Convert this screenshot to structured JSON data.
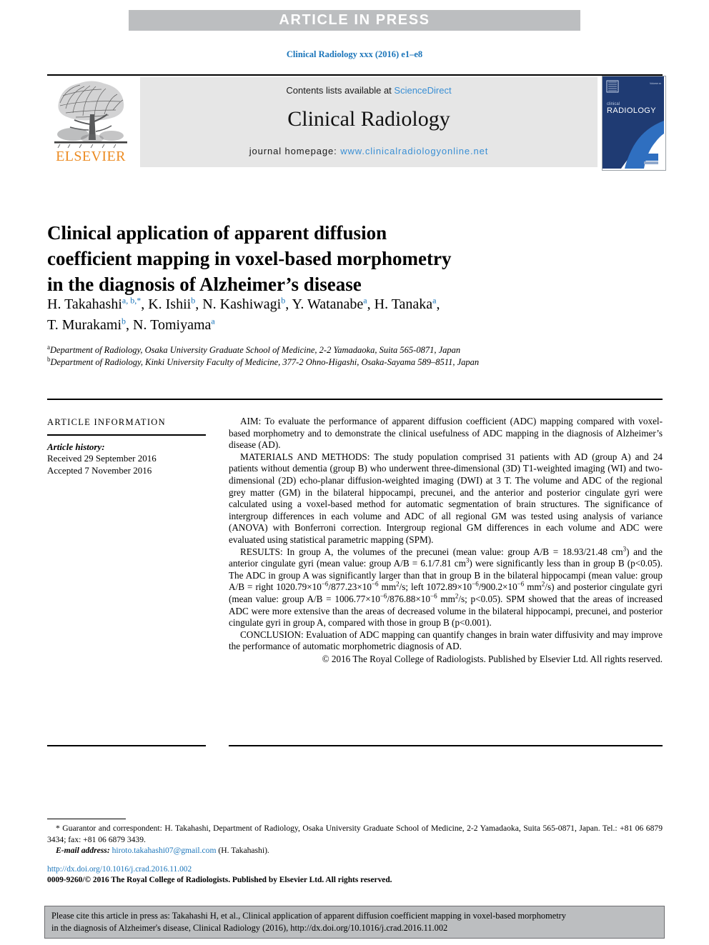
{
  "banner": {
    "text": "ARTICLE IN PRESS"
  },
  "running_head": "Clinical Radiology xxx (2016) e1–e8",
  "masthead": {
    "publisher_name": "ELSEVIER",
    "contents_prefix": "Contents lists available at ",
    "contents_link": "ScienceDirect",
    "journal_title": "Clinical Radiology",
    "homepage_prefix": "journal homepage: ",
    "homepage_link": "www.clinicalradiologyonline.net",
    "cover_title_small": "clinical",
    "cover_title_large": "RADIOLOGY",
    "accent_blue": "#1b75ba",
    "link_blue": "#3a8fd4",
    "elsevier_orange": "#ec8b22",
    "banner_grey": "#bcbec0",
    "masthead_grey": "#e6e6e6"
  },
  "article": {
    "title_line_1": "Clinical application of apparent diffusion",
    "title_line_2": "coefficient mapping in voxel-based morphometry",
    "title_line_3": "in the diagnosis of Alzheimer’s disease",
    "authors": [
      {
        "name": "H. Takahashi",
        "marks": "a, b,",
        "star": "*",
        "sep": ", "
      },
      {
        "name": "K. Ishii",
        "marks": "b",
        "star": "",
        "sep": ", "
      },
      {
        "name": "N. Kashiwagi",
        "marks": "b",
        "star": "",
        "sep": ", "
      },
      {
        "name": "Y. Watanabe",
        "marks": "a",
        "star": "",
        "sep": ", "
      },
      {
        "name": "H. Tanaka",
        "marks": "a",
        "star": "",
        "sep": ", "
      },
      {
        "name": "T. Murakami",
        "marks": "b",
        "star": "",
        "sep": ", "
      },
      {
        "name": "N. Tomiyama",
        "marks": "a",
        "star": "",
        "sep": ""
      }
    ],
    "affiliations": [
      {
        "mark": "a",
        "text": "Department of Radiology, Osaka University Graduate School of Medicine, 2-2 Yamadaoka, Suita 565-0871, Japan"
      },
      {
        "mark": "b",
        "text": "Department of Radiology, Kinki University Faculty of Medicine, 377-2 Ohno-Higashi, Osaka-Sayama 589–8511, Japan"
      }
    ]
  },
  "article_information": {
    "heading": "ARTICLE INFORMATION",
    "history_label": "Article history:",
    "received": "Received 29 September 2016",
    "accepted": "Accepted 7 November 2016"
  },
  "abstract": {
    "aim_label": "AIM:",
    "aim_text": " To evaluate the performance of apparent diffusion coefficient (ADC) mapping compared with voxel-based morphometry and to demonstrate the clinical usefulness of ADC mapping in the diagnosis of Alzheimer’s disease (AD).",
    "methods_label": "MATERIALS AND METHODS:",
    "methods_text": " The study population comprised 31 patients with AD (group A) and 24 patients without dementia (group B) who underwent three-dimensional (3D) T1-weighted imaging (WI) and two-dimensional (2D) echo-planar diffusion-weighted imaging (DWI) at 3 T. The volume and ADC of the regional grey matter (GM) in the bilateral hippocampi, precunei, and the anterior and posterior cingulate gyri were calculated using a voxel-based method for automatic segmentation of brain structures. The significance of intergroup differences in each volume and ADC of all regional GM was tested using analysis of variance (ANOVA) with Bonferroni correction. Intergroup regional GM differences in each volume and ADC were evaluated using statistical parametric mapping (SPM).",
    "results_label": "RESULTS:",
    "results_parts": {
      "p1": " In group A, the volumes of the precunei (mean value: group A/B = 18.93/21.48 cm",
      "sup1": "3",
      "p2": ") and the anterior cingulate gyri (mean value: group A/B = 6.1/7.81 cm",
      "sup2": "3",
      "p3": ") were significantly less than in group B (p<0.05). The ADC in group A was significantly larger than that in group B in the bilateral hippocampi (mean value: group A/B = right 1020.79×10",
      "sup3": "−6",
      "p4": "/877.23×10",
      "sup4": "−6",
      "p5": " mm",
      "sup5": "2",
      "p6": "/s; left 1072.89×10",
      "sup6": "−6",
      "p7": "/900.2×10",
      "sup7": "−6",
      "p8": " mm",
      "sup8": "2",
      "p9": "/s) and posterior cingulate gyri (mean value: group A/B = 1006.77×10",
      "sup9": "−6",
      "p10": "/876.88×10",
      "sup10": "−6",
      "p11": " mm",
      "sup11": "2",
      "p12": "/s; p<0.05). SPM showed that the areas of increased ADC were more extensive than the areas of decreased volume in the bilateral hippocampi, precunei, and posterior cingulate gyri in group A, compared with those in group B (p<0.001)."
    },
    "conclusion_label": "CONCLUSION:",
    "conclusion_text": " Evaluation of ADC mapping can quantify changes in brain water diffusivity and may improve the performance of automatic morphometric diagnosis of AD.",
    "copyright": "© 2016 The Royal College of Radiologists. Published by Elsevier Ltd. All rights reserved."
  },
  "footnote": {
    "correspondence": "* Guarantor and correspondent: H. Takahashi, Department of Radiology, Osaka University Graduate School of Medicine, 2-2 Yamadaoka, Suita 565-0871, Japan. Tel.: +81 06 6879 3434; fax: +81 06 6879 3439.",
    "email_label": "E-mail address:",
    "email": "hiroto.takahashi07@gmail.com",
    "email_suffix": " (H. Takahashi).",
    "doi_url": "http://dx.doi.org/10.1016/j.crad.2016.11.002",
    "issn_line": "0009-9260/© 2016 The Royal College of Radiologists. Published by Elsevier Ltd. All rights reserved."
  },
  "cite_box": {
    "line_1": "Please cite this article in press as: Takahashi H, et al., Clinical application of apparent diffusion coefficient mapping in voxel-based morphometry",
    "line_2": "in the diagnosis of Alzheimer's disease, Clinical Radiology (2016), http://dx.doi.org/10.1016/j.crad.2016.11.002"
  }
}
